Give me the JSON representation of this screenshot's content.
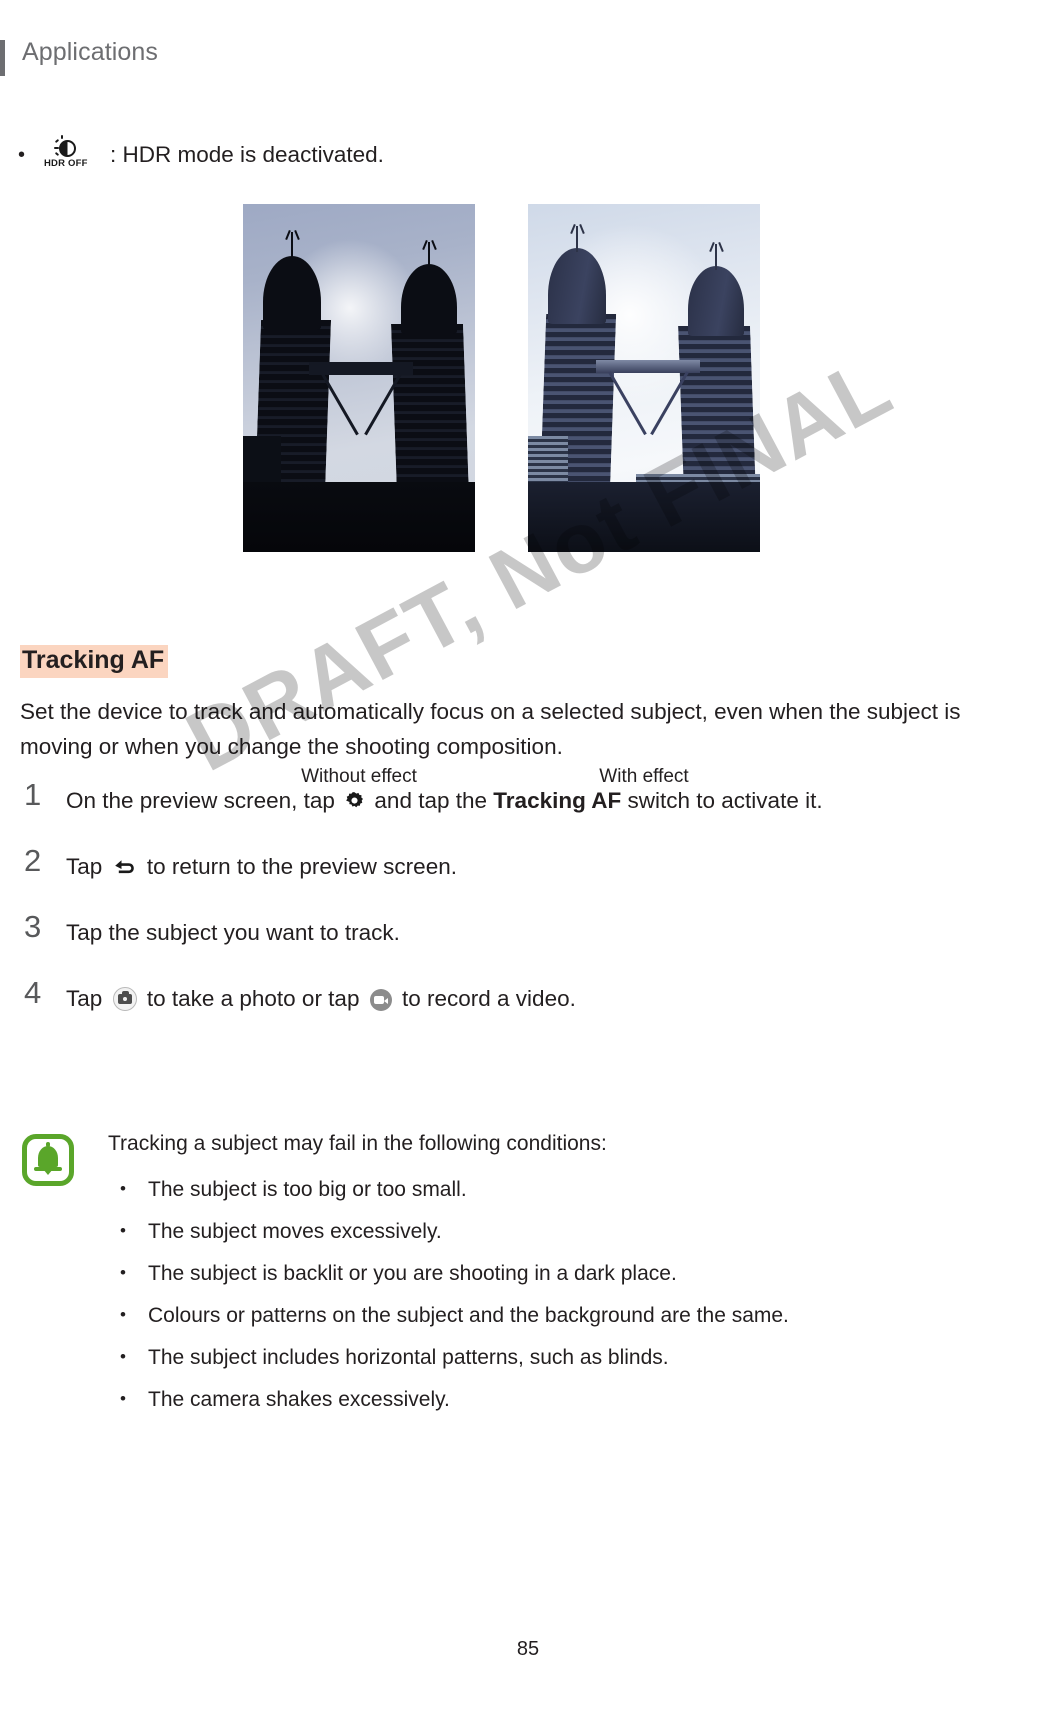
{
  "header": {
    "title": "Applications"
  },
  "hdr_note": {
    "bullet": "•",
    "icon_label": "HDR OFF",
    "icon_name": "hdr-off-icon",
    "text": ": HDR mode is deactivated."
  },
  "figures": [
    {
      "caption": "Without effect",
      "alt": "Petronas Twin Towers photographed against bright sky, towers appear as dark silhouette"
    },
    {
      "caption": "With effect",
      "alt": "Petronas Twin Towers with HDR applied, facade detail visible and sky balanced"
    }
  ],
  "section": {
    "heading": "Tracking AF",
    "highlight_color": "#fbd5c0",
    "paragraph": "Set the device to track and automatically focus on a selected subject, even when the subject is moving or when you change the shooting composition."
  },
  "steps": [
    {
      "number": "1",
      "text_before": "On the preview screen, tap",
      "icon": "gear-icon",
      "text_middle": "and tap the",
      "bold": "Tracking AF",
      "text_after": "switch to activate it."
    },
    {
      "number": "2",
      "text_before": "Tap",
      "icon": "back-arrow-icon",
      "text_after": "to return to the preview screen."
    },
    {
      "number": "3",
      "text_before": "Tap the subject you want to track."
    },
    {
      "number": "4",
      "text_before": "Tap",
      "icon": "camera-shutter-icon",
      "text_middle": "to take a photo or tap",
      "icon2": "video-record-icon",
      "text_after": "to record a video."
    }
  ],
  "note": {
    "icon": "bell-icon",
    "icon_color": "#5aa62a",
    "lead": "Tracking a subject may fail in the following conditions:",
    "items": [
      "The subject is too big or too small.",
      "The subject moves excessively.",
      "The subject is backlit or you are shooting in a dark place.",
      "Colours or patterns on the subject and the background are the same.",
      "The subject includes horizontal patterns, such as blinds.",
      "The camera shakes excessively."
    ]
  },
  "watermark": {
    "text": "DRAFT, Not FINAL"
  },
  "footer": {
    "page_number": "85"
  }
}
